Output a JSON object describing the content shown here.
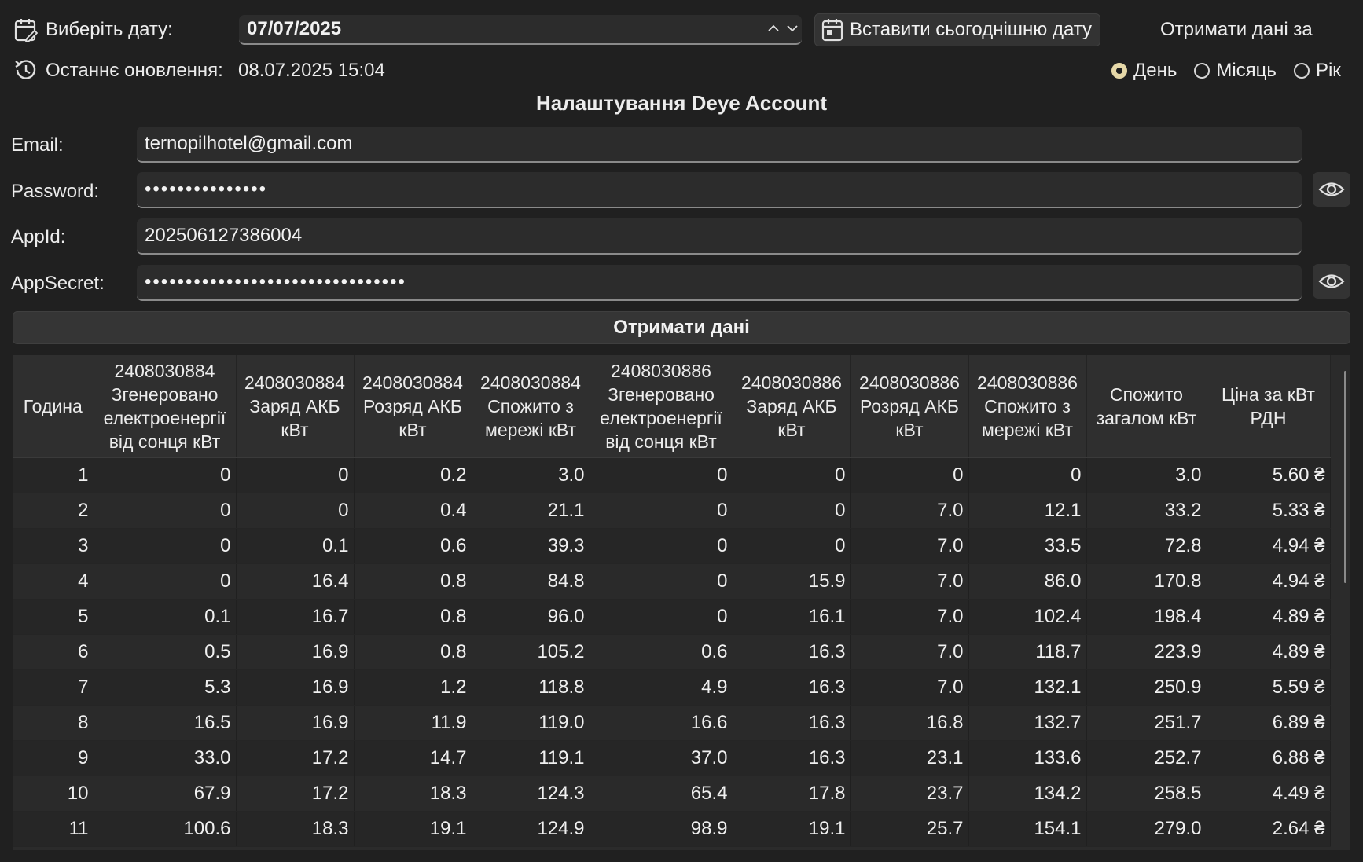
{
  "date_picker": {
    "label": "Виберіть дату:",
    "value": "07/07/2025",
    "today_button": "Вставити сьогоднішню дату"
  },
  "period": {
    "title": "Отримати дані за",
    "options": [
      "День",
      "Місяць",
      "Рік"
    ],
    "selected": "День"
  },
  "last_update": {
    "label": "Останнє оновлення:",
    "value": "08.07.2025 15:04"
  },
  "settings": {
    "title": "Налаштування Deye Account",
    "email_label": "Email:",
    "email_value": "ternopilhotel@gmail.com",
    "password_label": "Password:",
    "password_value": "•••••••••••••••",
    "appid_label": "AppId:",
    "appid_value": "202506127386004",
    "appsecret_label": "AppSecret:",
    "appsecret_value": "••••••••••••••••••••••••••••••••"
  },
  "fetch_button": "Отримати дані",
  "table": {
    "headers": [
      "Година",
      "2408030884 Згенеровано електроенергії від сонця кВт",
      "2408030884 Заряд АКБ кВт",
      "2408030884 Розряд АКБ кВт",
      "2408030884 Спожито з мережі кВт",
      "2408030886 Згенеровано електроенергії від сонця кВт",
      "2408030886 Заряд АКБ кВт",
      "2408030886 Розряд АКБ кВт",
      "2408030886 Спожито з мережі кВт",
      "Спожито загалом кВт",
      "Ціна за кВт РДН"
    ],
    "rows": [
      [
        "1",
        "0",
        "0",
        "0.2",
        "3.0",
        "0",
        "0",
        "0",
        "0",
        "3.0",
        "5.60 ₴"
      ],
      [
        "2",
        "0",
        "0",
        "0.4",
        "21.1",
        "0",
        "0",
        "7.0",
        "12.1",
        "33.2",
        "5.33 ₴"
      ],
      [
        "3",
        "0",
        "0.1",
        "0.6",
        "39.3",
        "0",
        "0",
        "7.0",
        "33.5",
        "72.8",
        "4.94 ₴"
      ],
      [
        "4",
        "0",
        "16.4",
        "0.8",
        "84.8",
        "0",
        "15.9",
        "7.0",
        "86.0",
        "170.8",
        "4.94 ₴"
      ],
      [
        "5",
        "0.1",
        "16.7",
        "0.8",
        "96.0",
        "0",
        "16.1",
        "7.0",
        "102.4",
        "198.4",
        "4.89 ₴"
      ],
      [
        "6",
        "0.5",
        "16.9",
        "0.8",
        "105.2",
        "0.6",
        "16.3",
        "7.0",
        "118.7",
        "223.9",
        "4.89 ₴"
      ],
      [
        "7",
        "5.3",
        "16.9",
        "1.2",
        "118.8",
        "4.9",
        "16.3",
        "7.0",
        "132.1",
        "250.9",
        "5.59 ₴"
      ],
      [
        "8",
        "16.5",
        "16.9",
        "11.9",
        "119.0",
        "16.6",
        "16.3",
        "16.8",
        "132.7",
        "251.7",
        "6.89 ₴"
      ],
      [
        "9",
        "33.0",
        "17.2",
        "14.7",
        "119.1",
        "37.0",
        "16.3",
        "23.1",
        "133.6",
        "252.7",
        "6.88 ₴"
      ],
      [
        "10",
        "67.9",
        "17.2",
        "18.3",
        "124.3",
        "65.4",
        "17.8",
        "23.7",
        "134.2",
        "258.5",
        "4.49 ₴"
      ],
      [
        "11",
        "100.6",
        "18.3",
        "19.1",
        "124.9",
        "98.9",
        "19.1",
        "25.7",
        "154.1",
        "279.0",
        "2.64 ₴"
      ]
    ]
  },
  "colors": {
    "background": "#202020",
    "field": "#2c2c2c",
    "radio_selected": "#e6d8a8"
  }
}
